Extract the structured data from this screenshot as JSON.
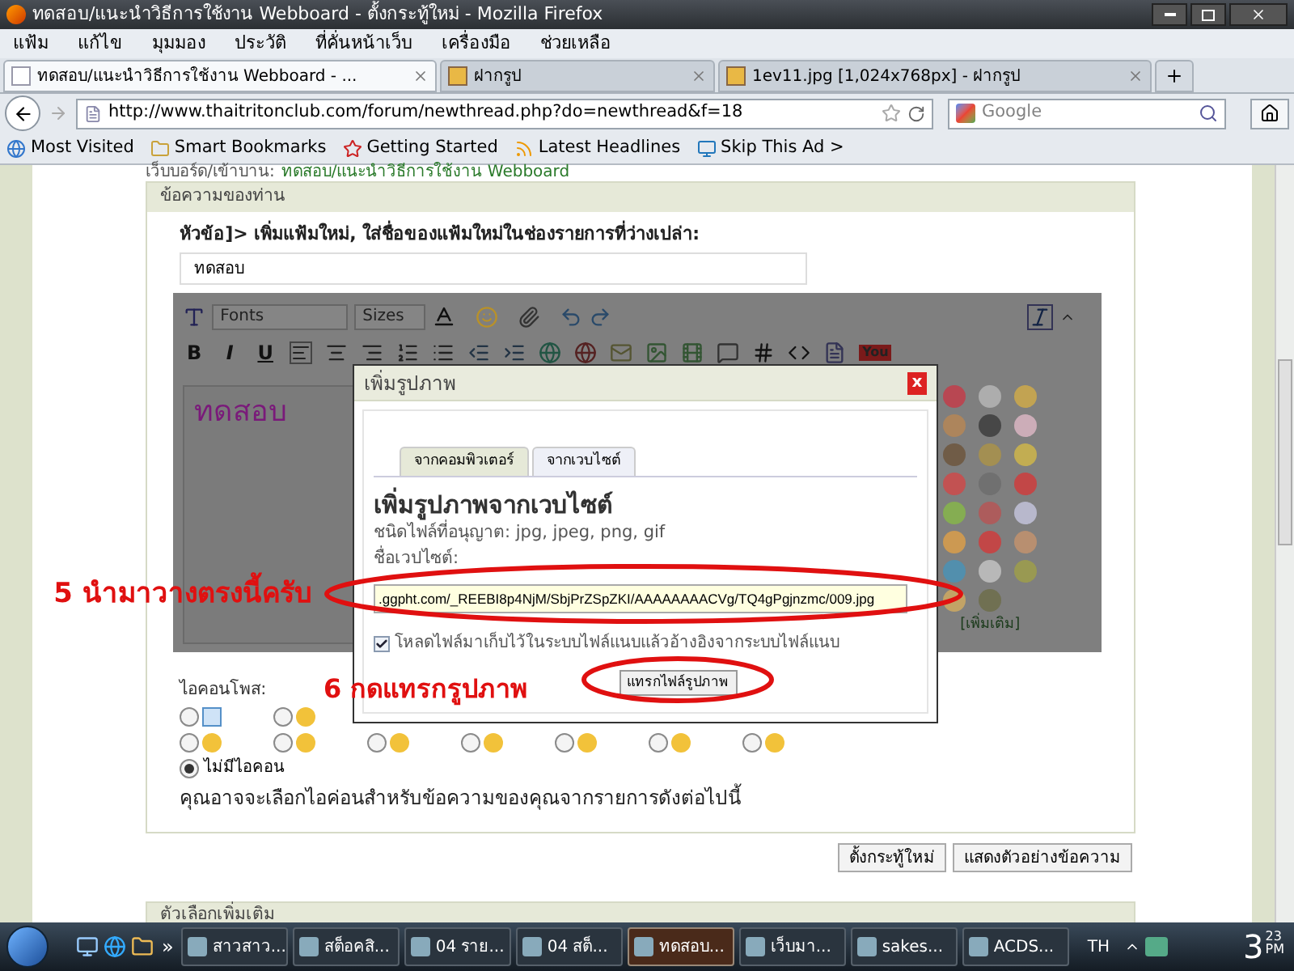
{
  "window": {
    "title": "ทดสอบ/แนะนำวิธีการใช้งาน Webboard - ตั้งกระทู้ใหม่ - Mozilla Firefox"
  },
  "menu": [
    "แฟ้ม",
    "แก้ไข",
    "มุมมอง",
    "ประวัติ",
    "ที่คั่นหน้าเว็บ",
    "เครื่องมือ",
    "ช่วยเหลือ"
  ],
  "tabs": [
    {
      "label": "ทดสอบ/แนะนำวิธีการใช้งาน Webboard - ...",
      "selected": true
    },
    {
      "label": "ฝากรูป",
      "selected": false
    },
    {
      "label": "1ev11.jpg [1,024x768px] - ฝากรูป",
      "selected": false
    }
  ],
  "address": {
    "url": "http://www.thaitritonclub.com/forum/newthread.php?do=newthread&f=18",
    "search_placeholder": "Google"
  },
  "bookmarks": [
    "Most Visited",
    "Smart Bookmarks",
    "Getting Started",
    "Latest Headlines",
    "Skip This Ad >"
  ],
  "breadcrumb": {
    "prefix": "เว็บบอร์ด/เข้าบาน:",
    "link": "ทดสอบ/แนะนำวิธีการใช้งาน Webboard"
  },
  "message_panel": {
    "header": "ข้อความของท่าน",
    "subject_label": "หัวข้อ]> เพิ่มแฟ้มใหม่, ใส่ชื่อของแฟ้มใหม่ในช่องรายการที่ว่างเปล่า:",
    "subject_value": "ทดสอบ",
    "editor": {
      "font_select": "Fonts",
      "size_select": "Sizes",
      "format_buttons": [
        "B",
        "I",
        "U"
      ],
      "video_label": "You",
      "body": "ทดสอบ",
      "more_smilies": "[เพิ่มเติม]"
    },
    "post_icon_label": "ไอคอนโพส:",
    "post_icon_rows": [
      [
        {
          "selected": false
        },
        {
          "selected": false
        }
      ],
      [
        {
          "selected": false
        },
        {
          "selected": false
        },
        {
          "selected": false
        },
        {
          "selected": false
        },
        {
          "selected": false
        },
        {
          "selected": false
        },
        {
          "selected": false
        }
      ]
    ],
    "no_icon": {
      "label": "ไม่มีไอคอน",
      "selected": true
    },
    "hint": "คุณอาจจะเลือกไอค่อนสำหรับข้อความของคุณจากรายการดังต่อไปนี้"
  },
  "buttons": [
    "ตั้งกระทู้ใหม่",
    "แสดงตัวอย่างข้อความ"
  ],
  "options_panel": {
    "header": "ตัวเลือกเพิ่มเติม"
  },
  "dialog": {
    "title": "เพิ่มรูปภาพ",
    "close": "x",
    "tabs": [
      {
        "label": "จากคอมพิวเตอร์",
        "selected": false
      },
      {
        "label": "จากเวบไซต์",
        "selected": true
      }
    ],
    "heading": "เพิ่มรูปภาพจากเวบไซต์",
    "allowed": "ชนิดไฟล์ที่อนุญาต: jpg, jpeg, png, gif",
    "url_label": "ชื่อเวปไซต์:",
    "url_value": ".ggpht.com/_REEBI8p4NjM/SbjPrZSpZKI/AAAAAAAACVg/TQ4gPgjnzmc/009.jpg",
    "download_checkbox": {
      "label": "โหลดไฟล์มาเก็บไว้ในระบบไฟล์แนบแล้วอ้างอิงจากระบบไฟล์แนบ",
      "checked": true
    },
    "insert_button": "แทรกไฟล์รูปภาพ"
  },
  "annotations": [
    "5 นำมาวางตรงนี้ครับ",
    "6 กดแทรกรูปภาพ"
  ],
  "taskbar": {
    "items": [
      {
        "label": "สาวสาว...",
        "selected": false
      },
      {
        "label": "สต็อคสิ...",
        "selected": false
      },
      {
        "label": "04 ราย...",
        "selected": false
      },
      {
        "label": "04 สต็...",
        "selected": false
      },
      {
        "label": "ทดสอบ...",
        "selected": true
      },
      {
        "label": "เว็บมา...",
        "selected": false
      },
      {
        "label": "sakes...",
        "selected": false
      },
      {
        "label": "ACDS...",
        "selected": false
      }
    ],
    "more": "»",
    "language": "TH",
    "clock": {
      "hour": "3",
      "minute": "23",
      "ampm": "PM"
    }
  }
}
